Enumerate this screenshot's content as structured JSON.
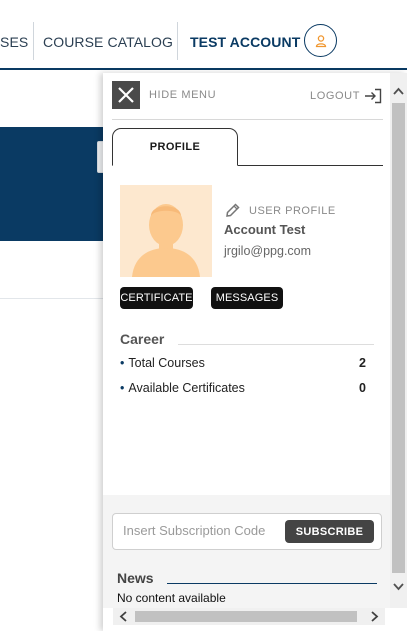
{
  "topnav": {
    "courses_label": "SES",
    "catalog_label": "COURSE CATALOG",
    "account_label": "TEST ACCOUNT",
    "avatar_icon": "user-icon",
    "accent_color": "#0a3a63"
  },
  "menu": {
    "close_icon": "close-icon",
    "hide_label": "HIDE MENU",
    "logout_label": "LOGOUT",
    "logout_icon": "logout-icon",
    "tabs": [
      {
        "label": "PROFILE",
        "selected": true
      }
    ],
    "profile": {
      "edit_label": "USER PROFILE",
      "edit_icon": "pencil-icon",
      "name": "Account Test",
      "email": "jrgilo@ppg.com",
      "certificate_button": "CERTIFICATE",
      "messages_button": "MESSAGES"
    },
    "career": {
      "title": "Career",
      "stats": [
        {
          "label": "Total Courses",
          "value": "2"
        },
        {
          "label": "Available Certificates",
          "value": "0"
        }
      ]
    },
    "subscription": {
      "placeholder": "Insert Subscription Code",
      "value": "",
      "button_label": "SUBSCRIBE"
    },
    "news": {
      "title": "News",
      "empty_text": "No content available"
    }
  }
}
